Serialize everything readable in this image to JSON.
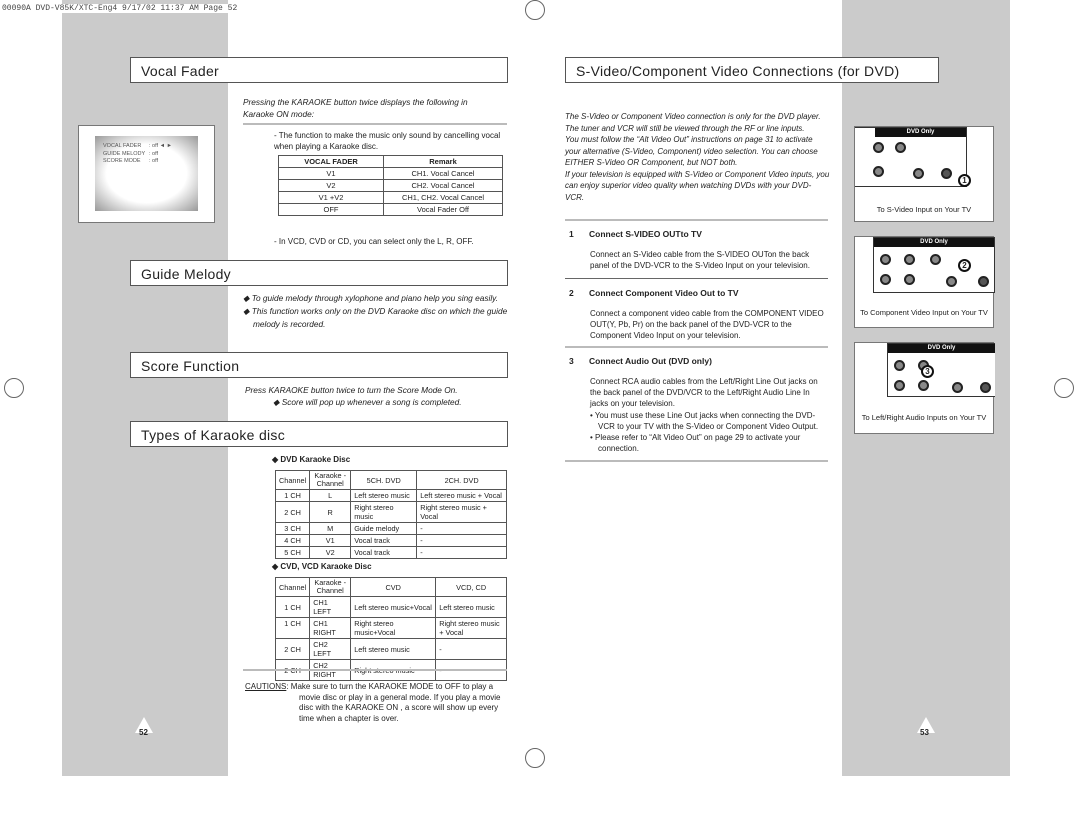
{
  "slug": "00090A DVD-V85K/XTC-Eng4  9/17/02 11:37 AM  Page 52",
  "left": {
    "page_number": "52",
    "vocal_fader": {
      "title": "Vocal Fader",
      "intro": "Pressing the KARAOKE button twice displays the following in Karaoke ON mode:",
      "osd": [
        {
          "label": "VOCAL FADER",
          "value": ": off ◄ ►"
        },
        {
          "label": "GUIDE MELODY",
          "value": ": off"
        },
        {
          "label": "SCORE MODE",
          "value": ": off"
        }
      ],
      "note1": "- The function to make the music only sound by cancelling vocal when playing a Karaoke disc.",
      "table": {
        "headers": [
          "VOCAL FADER",
          "Remark"
        ],
        "rows": [
          [
            "V1",
            "CH1. Vocal Cancel"
          ],
          [
            "V2",
            "CH2. Vocal Cancel"
          ],
          [
            "V1 +V2",
            "CH1, CH2. Vocal Cancel"
          ],
          [
            "OFF",
            "Vocal Fader Off"
          ]
        ]
      },
      "note2": "- In VCD, CVD or CD, you can select only the L, R, OFF."
    },
    "guide_melody": {
      "title": "Guide Melody",
      "bullets": [
        "To guide melody through xylophone and piano help you sing easily.",
        "This function works only on the DVD Karaoke disc on which the guide melody is recorded."
      ]
    },
    "score_function": {
      "title": "Score Function",
      "text": "Press KARAOKE button twice to turn the Score Mode On.",
      "bullet": "Score will pop up whenever a song is completed."
    },
    "types": {
      "title": "Types of Karaoke disc",
      "dvd": {
        "heading": "DVD Karaoke Disc",
        "headers": [
          "Channel",
          "Karaoke -Channel",
          "5CH. DVD",
          "2CH. DVD"
        ],
        "rows": [
          [
            "1 CH",
            "L",
            "Left stereo music",
            "Left stereo music + Vocal"
          ],
          [
            "2 CH",
            "R",
            "Right stereo music",
            "Right stereo music + Vocal"
          ],
          [
            "3 CH",
            "M",
            "Guide melody",
            "-"
          ],
          [
            "4 CH",
            "V1",
            "Vocal track",
            "-"
          ],
          [
            "5 CH",
            "V2",
            "Vocal track",
            "-"
          ]
        ]
      },
      "cvd": {
        "heading": "CVD, VCD Karaoke Disc",
        "headers": [
          "Channel",
          "Karaoke -Channel",
          "CVD",
          "VCD, CD"
        ],
        "rows": [
          [
            "1 CH",
            "CH1 LEFT",
            "Left stereo music+Vocal",
            "Left stereo music"
          ],
          [
            "1 CH",
            "CH1 RIGHT",
            "Right stereo music+Vocal",
            "Right stereo music + Vocal"
          ],
          [
            "2 CH",
            "CH2 LEFT",
            "Left stereo music",
            "-"
          ],
          [
            "2 CH",
            "CH2 RIGHT",
            "Right stereo music",
            "-"
          ]
        ]
      }
    },
    "caution": {
      "label": "CAUTIONS",
      "text": ": Make sure to turn the KARAOKE MODE to OFF to play a movie disc or play in a general mode. If you play a movie disc with the KARAOKE ON , a score will show up every time when a chapter is over."
    }
  },
  "right": {
    "page_number": "53",
    "title": "S-Video/Component Video Connections (for DVD)",
    "intro": "The S-Video or Component Video connection is only for the DVD player. The tuner and VCR will still be viewed through the RF or line inputs.\nYou must follow the “Alt Video Out” instructions on page 31 to activate your alternative (S-Video, Component) video selection. You can choose EITHER S-Video OR Component, but NOT both.\nIf your television is equipped with S-Video or Component Video inputs, you can enjoy superior video quality when watching DVDs with your DVD-VCR.",
    "steps": [
      {
        "num": "1",
        "title": "Connect S-VIDEO OUTto TV",
        "text": "Connect an S-Video cable from the S-VIDEO OUTon the back panel of the DVD-VCR to the S-Video Input on your television."
      },
      {
        "num": "2",
        "title": "Connect Component Video Out to TV",
        "text": "Connect a component video cable from the COMPONENT VIDEO OUT(Y, Pb, Pr) on the back panel of the DVD-VCR to the Component Video Input on your television."
      },
      {
        "num": "3",
        "title": "Connect Audio Out (DVD only)",
        "text": "Connect RCA audio cables from the Left/Right Line Out jacks on the back panel of the DVD/VCR to the Left/Right Audio Line In jacks on your television.",
        "bullets": [
          "You must use these Line Out jacks when connecting the DVD-VCR to your TV with the S-Video or Component Video Output.",
          "Please refer to “Alt Video Out” on page 29 to activate your connection."
        ]
      }
    ],
    "figures": [
      {
        "panel_label": "DVD Only",
        "marker": "1",
        "caption": "To S-Video Input on Your TV"
      },
      {
        "panel_label": "DVD Only",
        "marker": "2",
        "caption": "To Component Video Input on Your TV"
      },
      {
        "panel_label": "DVD Only",
        "marker": "3",
        "caption": "To Left/Right Audio Inputs on Your TV"
      }
    ]
  }
}
